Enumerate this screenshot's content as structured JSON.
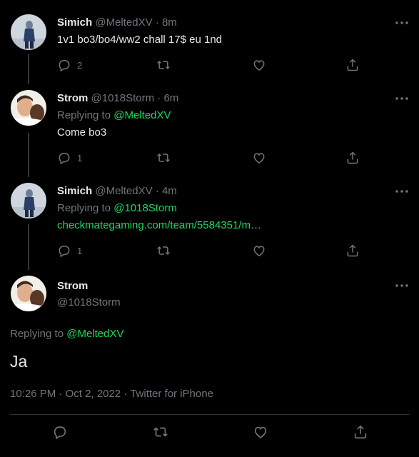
{
  "thread": [
    {
      "name": "Simich",
      "handle": "@MeltedXV",
      "time": "8m",
      "text": "1v1 bo3/bo4/ww2 chall 17$ eu 1nd",
      "replies": "2",
      "retweets": "",
      "likes": ""
    },
    {
      "name": "Strom",
      "handle": "@1018Storm",
      "time": "6m",
      "replying_label": "Replying to",
      "replying_to": "@MeltedXV",
      "text": "Come bo3",
      "replies": "1",
      "retweets": "",
      "likes": ""
    },
    {
      "name": "Simich",
      "handle": "@MeltedXV",
      "time": "4m",
      "replying_label": "Replying to",
      "replying_to": "@1018Storm",
      "link": "checkmategaming.com/team/5584351/m…",
      "replies": "1",
      "retweets": "",
      "likes": ""
    }
  ],
  "main": {
    "name": "Strom",
    "handle": "@1018Storm",
    "replying_label": "Replying to",
    "replying_to": "@MeltedXV",
    "text": "Ja",
    "time": "10:26 PM",
    "date": "Oct 2, 2022",
    "source": "Twitter for iPhone"
  },
  "separator": "·",
  "icons": {
    "reply": "reply-icon",
    "retweet": "retweet-icon",
    "like": "heart-icon",
    "share": "share-icon",
    "more": "more-icon"
  },
  "colors": {
    "background": "#000000",
    "accent_link": "#1ed760",
    "muted": "#71767b"
  }
}
